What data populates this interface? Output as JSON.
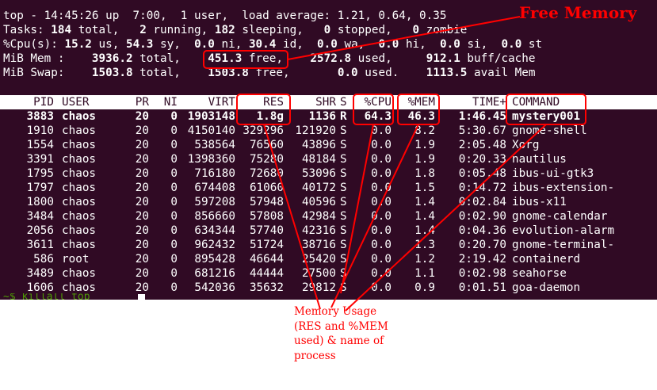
{
  "summary": {
    "line1": "top - 14:45:26 up  7:00,  1 user,  load average: 1.21, 0.64, 0.35",
    "tasks": {
      "label": "Tasks:",
      "total": "184",
      "total_lbl": "total,",
      "running": "2",
      "running_lbl": "running,",
      "sleeping": "182",
      "sleeping_lbl": "sleeping,",
      "stopped": "0",
      "stopped_lbl": "stopped,",
      "zombie": "0",
      "zombie_lbl": "zombie"
    },
    "cpu": {
      "label": "%Cpu(s):",
      "us": "15.2",
      "us_lbl": "us,",
      "sy": "54.3",
      "sy_lbl": "sy,",
      "ni": "0.0",
      "ni_lbl": "ni,",
      "id": "30.4",
      "id_lbl": "id,",
      "wa": "0.0",
      "wa_lbl": "wa,",
      "hi": "0.0",
      "hi_lbl": "hi,",
      "si": "0.0",
      "si_lbl": "si,",
      "st": "0.0",
      "st_lbl": "st"
    },
    "mem": {
      "label": "MiB Mem :",
      "total": "3936.2",
      "total_lbl": "total,",
      "free": "451.3",
      "free_lbl": "free,",
      "used": "2572.8",
      "used_lbl": "used,",
      "buff": "912.1",
      "buff_lbl": "buff/cache"
    },
    "swap": {
      "label": "MiB Swap:",
      "total": "1503.8",
      "total_lbl": "total,",
      "free": "1503.8",
      "free_lbl": "free,",
      "used": "0.0",
      "used_lbl": "used.",
      "avail": "1113.5",
      "avail_lbl": "avail Mem"
    }
  },
  "table": {
    "headers": [
      "PID",
      "USER",
      "PR",
      "NI",
      "VIRT",
      "RES",
      "SHR",
      "S",
      "%CPU",
      "%MEM",
      "TIME+",
      "COMMAND"
    ],
    "rows": [
      [
        "3883",
        "chaos",
        "20",
        "0",
        "1903148",
        "1.8g",
        "1136",
        "R",
        "64.3",
        "46.3",
        "1:46.45",
        "mystery001"
      ],
      [
        "1910",
        "chaos",
        "20",
        "0",
        "4150140",
        "329296",
        "121920",
        "S",
        "0.0",
        "8.2",
        "5:30.67",
        "gnome-shell"
      ],
      [
        "1554",
        "chaos",
        "20",
        "0",
        "538564",
        "76560",
        "43896",
        "S",
        "0.0",
        "1.9",
        "2:05.48",
        "Xorg"
      ],
      [
        "3391",
        "chaos",
        "20",
        "0",
        "1398360",
        "75280",
        "48184",
        "S",
        "0.0",
        "1.9",
        "0:20.33",
        "nautilus"
      ],
      [
        "1795",
        "chaos",
        "20",
        "0",
        "716180",
        "72680",
        "53096",
        "S",
        "0.0",
        "1.8",
        "0:05.48",
        "ibus-ui-gtk3"
      ],
      [
        "1797",
        "chaos",
        "20",
        "0",
        "674408",
        "61060",
        "40172",
        "S",
        "0.0",
        "1.5",
        "0:14.72",
        "ibus-extension-"
      ],
      [
        "1800",
        "chaos",
        "20",
        "0",
        "597208",
        "57948",
        "40596",
        "S",
        "0.0",
        "1.4",
        "0:02.84",
        "ibus-x11"
      ],
      [
        "3484",
        "chaos",
        "20",
        "0",
        "856660",
        "57808",
        "42984",
        "S",
        "0.0",
        "1.4",
        "0:02.90",
        "gnome-calendar"
      ],
      [
        "2056",
        "chaos",
        "20",
        "0",
        "634344",
        "57740",
        "42316",
        "S",
        "0.0",
        "1.4",
        "0:04.36",
        "evolution-alarm"
      ],
      [
        "3611",
        "chaos",
        "20",
        "0",
        "962432",
        "51724",
        "38716",
        "S",
        "0.0",
        "1.3",
        "0:20.70",
        "gnome-terminal-"
      ],
      [
        "586",
        "root",
        "20",
        "0",
        "895428",
        "46644",
        "25420",
        "S",
        "0.0",
        "1.2",
        "2:19.42",
        "containerd"
      ],
      [
        "3489",
        "chaos",
        "20",
        "0",
        "681216",
        "44444",
        "27500",
        "S",
        "0.0",
        "1.1",
        "0:02.98",
        "seahorse"
      ],
      [
        "1606",
        "chaos",
        "20",
        "0",
        "542036",
        "35632",
        "29812",
        "S",
        "0.0",
        "0.9",
        "0:01.51",
        "goa-daemon"
      ]
    ]
  },
  "prompt_text": "~$ killall top",
  "annotations": {
    "free_memory": "Free Memory",
    "note_lines": [
      "Memory Usage",
      "(RES and %MEM",
      "used) & name of",
      "process"
    ]
  },
  "colors": {
    "terminal_bg": "#300a24",
    "annotation": "#ff0000",
    "prompt_green": "#4e9a06"
  }
}
